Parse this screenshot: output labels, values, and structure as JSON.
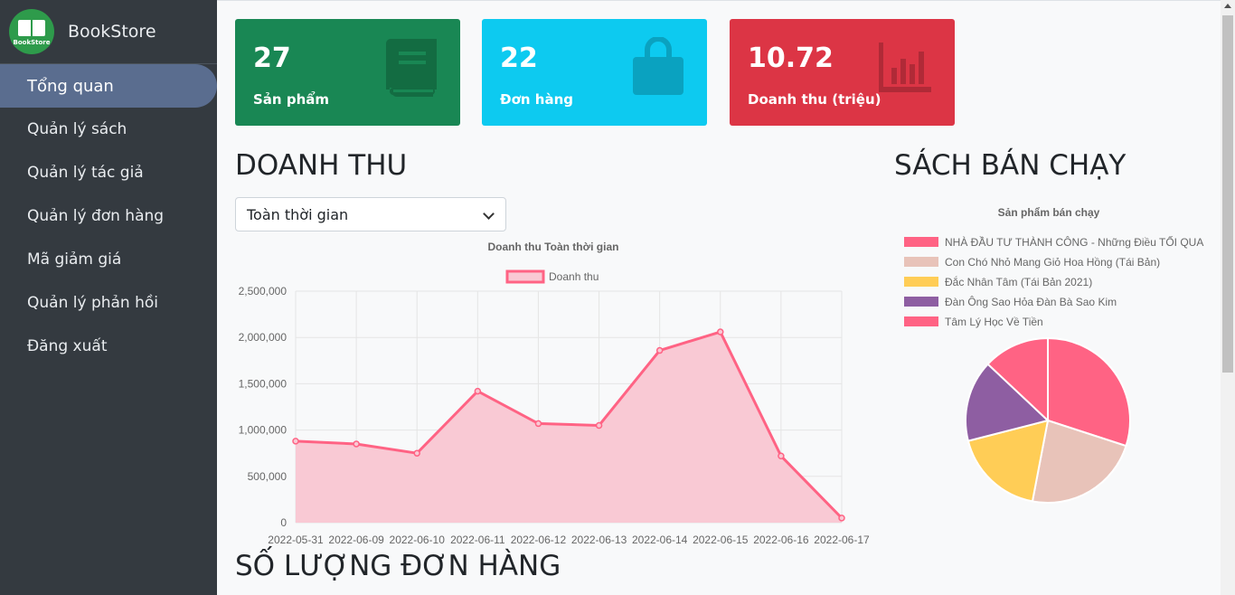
{
  "sidebar": {
    "brand": "BookStore",
    "logo_text": "BookStore",
    "items": [
      {
        "label": "Tổng quan",
        "active": true
      },
      {
        "label": "Quản lý sách"
      },
      {
        "label": "Quản lý tác giả"
      },
      {
        "label": "Quản lý đơn hàng"
      },
      {
        "label": "Mã giảm giá"
      },
      {
        "label": "Quản lý phản hồi"
      },
      {
        "label": "Đăng xuất"
      }
    ]
  },
  "cards": [
    {
      "value": "27",
      "label": "Sản phẩm",
      "color": "#198754",
      "icon": "book-icon"
    },
    {
      "value": "22",
      "label": "Đơn hàng",
      "color": "#0dcaf0",
      "icon": "shopping-bag-icon"
    },
    {
      "value": "10.72",
      "label": "Doanh thu (triệu)",
      "color": "#dc3545",
      "icon": "bar-chart-icon"
    }
  ],
  "revenue": {
    "heading": "DOANH THU",
    "select_value": "Toàn thời gian"
  },
  "bestseller": {
    "heading": "SÁCH BÁN CHẠY"
  },
  "orders": {
    "heading": "SỐ LƯỢNG ĐƠN HÀNG"
  },
  "chart_data": [
    {
      "type": "area",
      "title": "Doanh thu Toàn thời gian",
      "legend_position": "top",
      "categories": [
        "2022-05-31",
        "2022-06-09",
        "2022-06-10",
        "2022-06-11",
        "2022-06-12",
        "2022-06-13",
        "2022-06-14",
        "2022-06-15",
        "2022-06-16",
        "2022-06-17"
      ],
      "series": [
        {
          "name": "Doanh thu",
          "values": [
            880000,
            850000,
            750000,
            1420000,
            1070000,
            1050000,
            1860000,
            2060000,
            720000,
            50000
          ],
          "color": "#ff6384",
          "fill": "#f9c9d4"
        }
      ],
      "ylim": [
        0,
        2500000
      ],
      "yticks": [
        "2,500,000",
        "2,000,000",
        "1,500,000",
        "1,000,000",
        "500,000",
        "0"
      ],
      "grid": true
    },
    {
      "type": "pie",
      "title": "Sản phẩm bán chạy",
      "legend_position": "top",
      "labels": [
        "NHÀ ĐẦU TƯ THÀNH CÔNG - Những Điều TỐI QUA",
        "Con Chó Nhỏ Mang Giỏ Hoa Hồng (Tái Bản)",
        "Đắc Nhân Tâm (Tái Bản 2021)",
        "Đàn Ông Sao Hỏa Đàn Bà Sao Kim",
        "Tâm Lý Học Về Tiền"
      ],
      "values": [
        30,
        23,
        18,
        16,
        13
      ],
      "colors": [
        "#ff6384",
        "#e8c3b9",
        "#ffcd56",
        "#8e5ea2",
        "#ff6384"
      ]
    }
  ]
}
